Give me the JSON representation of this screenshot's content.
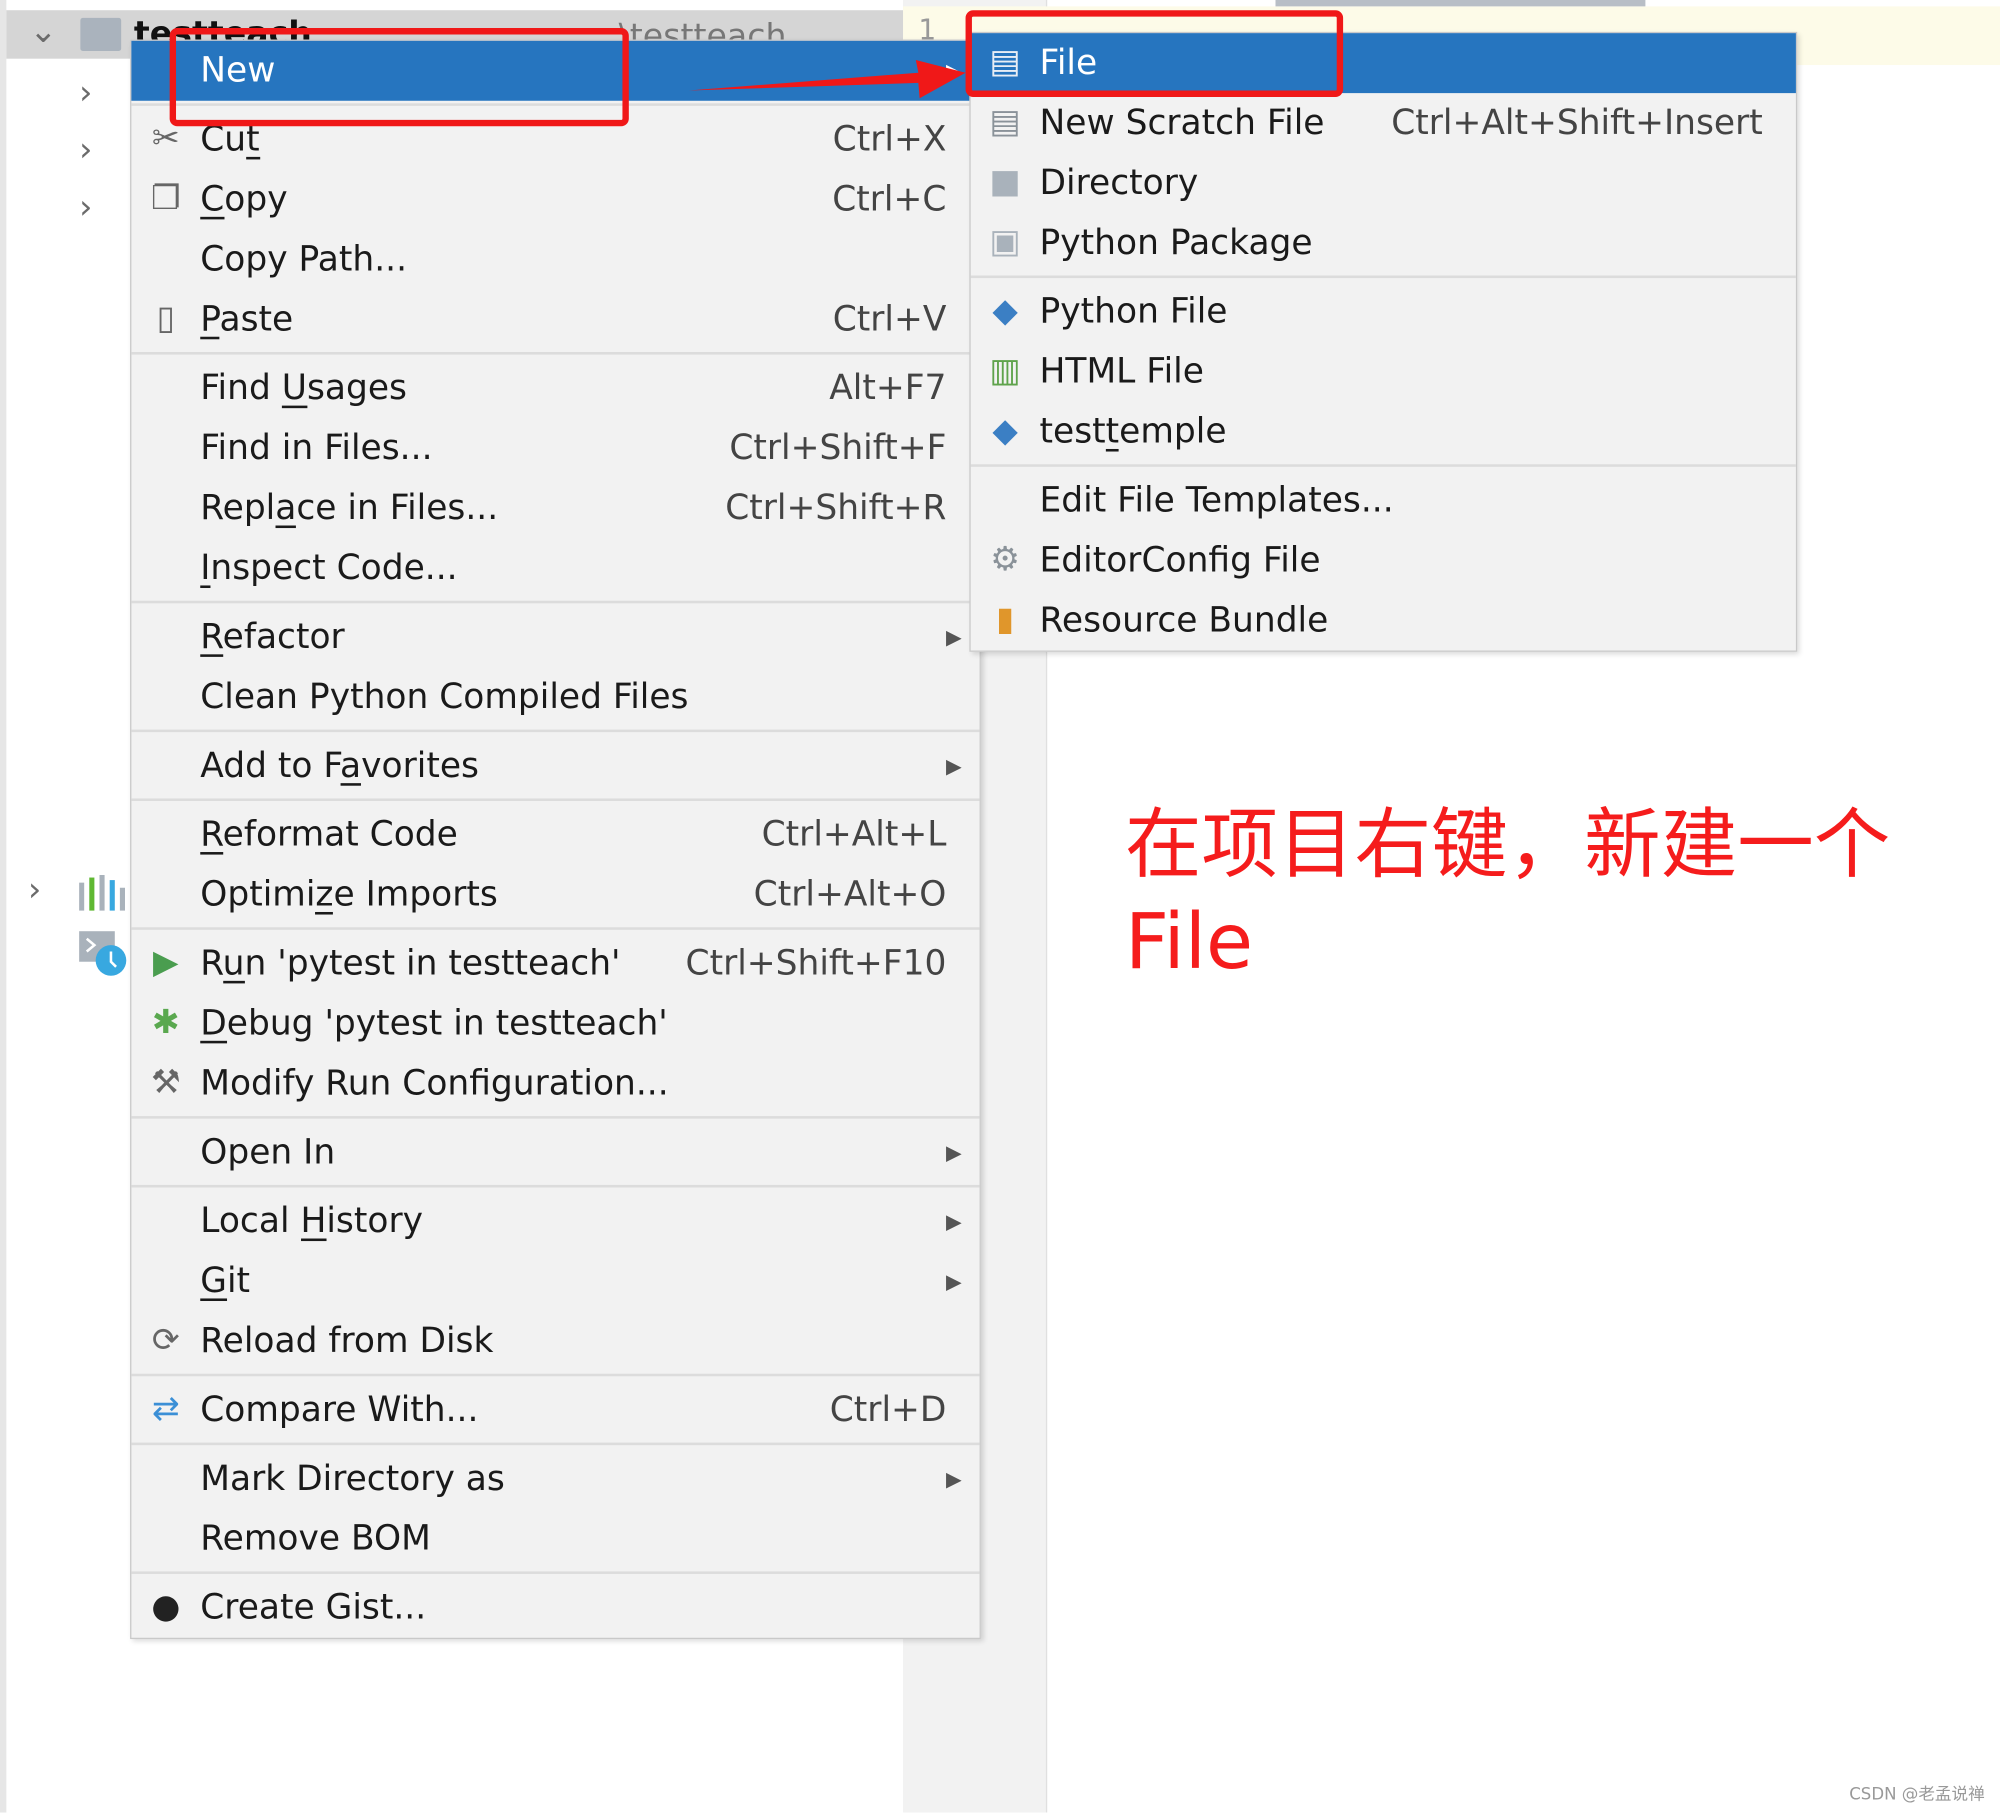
{
  "project_tree": {
    "root_label": "testteach",
    "root_path_fragment": "\\testteach",
    "line_number": "1"
  },
  "context_menu": {
    "items": [
      {
        "label": "New",
        "arrow": true,
        "selected": true
      },
      {
        "sep": true
      },
      {
        "label": "Cut",
        "mn": 2,
        "shortcut": "Ctrl+X",
        "icon": "scissors-icon"
      },
      {
        "label": "Copy",
        "mn": 0,
        "shortcut": "Ctrl+C",
        "icon": "copy-icon"
      },
      {
        "label": "Copy Path...",
        "shortcut": ""
      },
      {
        "label": "Paste",
        "mn": 0,
        "shortcut": "Ctrl+V",
        "icon": "paste-icon"
      },
      {
        "sep": true
      },
      {
        "label": "Find Usages",
        "mn": 5,
        "shortcut": "Alt+F7"
      },
      {
        "label": "Find in Files...",
        "shortcut": "Ctrl+Shift+F"
      },
      {
        "label": "Replace in Files...",
        "mn": 4,
        "shortcut": "Ctrl+Shift+R"
      },
      {
        "label": "Inspect Code...",
        "mn": 0
      },
      {
        "sep": true
      },
      {
        "label": "Refactor",
        "mn": 0,
        "arrow": true
      },
      {
        "label": "Clean Python Compiled Files"
      },
      {
        "sep": true
      },
      {
        "label": "Add to Favorites",
        "mn": 8,
        "arrow": true
      },
      {
        "sep": true
      },
      {
        "label": "Reformat Code",
        "mn": 0,
        "shortcut": "Ctrl+Alt+L"
      },
      {
        "label": "Optimize Imports",
        "mn": 6,
        "shortcut": "Ctrl+Alt+O"
      },
      {
        "sep": true
      },
      {
        "label": "Run 'pytest in testteach'",
        "mn": 1,
        "shortcut": "Ctrl+Shift+F10",
        "icon": "run-icon"
      },
      {
        "label": "Debug 'pytest in testteach'",
        "mn": 0,
        "icon": "debug-icon"
      },
      {
        "label": "Modify Run Configuration...",
        "icon": "wrench-icon"
      },
      {
        "sep": true
      },
      {
        "label": "Open In",
        "arrow": true
      },
      {
        "sep": true
      },
      {
        "label": "Local History",
        "mn": 6,
        "arrow": true
      },
      {
        "label": "Git",
        "mn": 0,
        "arrow": true
      },
      {
        "label": "Reload from Disk",
        "icon": "reload-icon"
      },
      {
        "sep": true
      },
      {
        "label": "Compare With...",
        "shortcut": "Ctrl+D",
        "icon": "compare-icon"
      },
      {
        "sep": true
      },
      {
        "label": "Mark Directory as",
        "arrow": true
      },
      {
        "label": "Remove BOM"
      },
      {
        "sep": true
      },
      {
        "label": "Create Gist...",
        "icon": "github-icon"
      }
    ]
  },
  "new_submenu": {
    "items": [
      {
        "label": "File",
        "selected": true,
        "icon": "file-icon"
      },
      {
        "label": "New Scratch File",
        "shortcut": "Ctrl+Alt+Shift+Insert",
        "icon": "scratch-file-icon"
      },
      {
        "label": "Directory",
        "icon": "folder-icon"
      },
      {
        "label": "Python Package",
        "icon": "package-icon"
      },
      {
        "sep": true
      },
      {
        "label": "Python File",
        "icon": "python-file-icon"
      },
      {
        "label": "HTML File",
        "icon": "html-file-icon"
      },
      {
        "label": "testtemple",
        "mn": 4,
        "icon": "python-file-icon"
      },
      {
        "sep": true
      },
      {
        "label": "Edit File Templates..."
      },
      {
        "label": "EditorConfig File",
        "icon": "gear-icon"
      },
      {
        "label": "Resource Bundle",
        "icon": "resource-bundle-icon"
      }
    ]
  },
  "annotation": {
    "line1": "在项目右键，新建一个",
    "line2": "File",
    "color": "#f51c1c"
  },
  "watermark": "CSDN @老孟说禅",
  "colors": {
    "selection": "#2675bf",
    "menu_bg": "#f2f2f2",
    "annotation_red": "#f01818"
  }
}
